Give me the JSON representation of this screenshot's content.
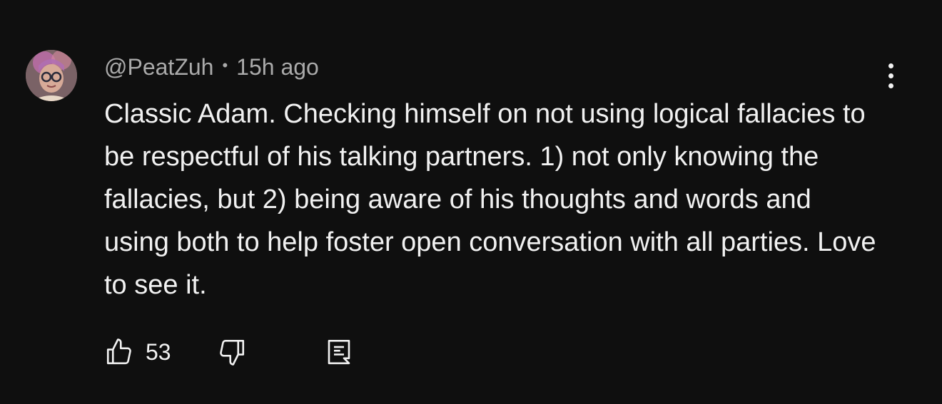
{
  "comment": {
    "author": "@PeatZuh",
    "separator": "•",
    "timestamp": "15h ago",
    "text": "Classic Adam. Checking himself on not using logical fallacies to be respectful of his talking partners. 1) not only knowing the fallacies, but 2) being aware of his thoughts and words and using both to help foster open conversation with all parties. Love to see it.",
    "like_count": "53"
  },
  "icons": {
    "avatar": "avatar-image",
    "menu": "more-vertical-icon",
    "like": "thumbs-up-icon",
    "dislike": "thumbs-down-icon",
    "reply": "reply-comment-icon"
  },
  "colors": {
    "background": "#0f0f0f",
    "primary_text": "#f1f1f1",
    "secondary_text": "#aaaaaa"
  }
}
